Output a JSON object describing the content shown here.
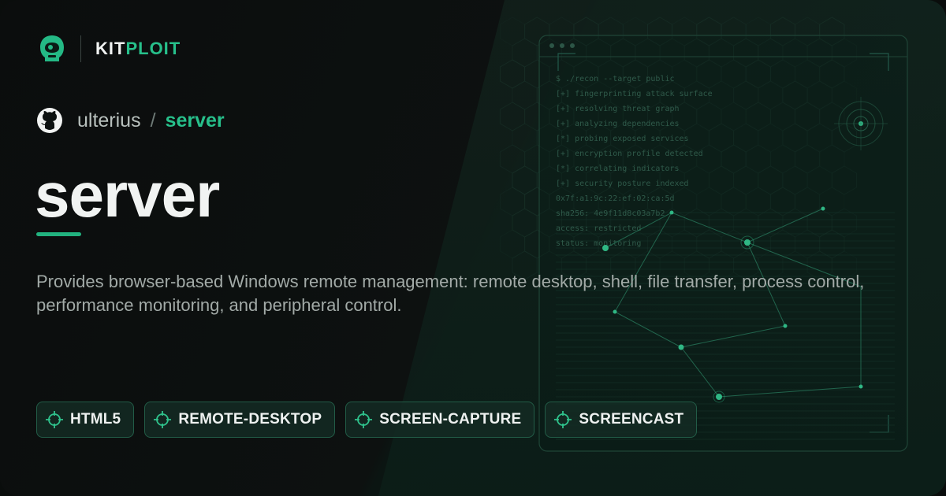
{
  "brand": {
    "name_part1": "KIT",
    "name_part2": "PLOIT",
    "logo_icon": "helmet-logo-icon"
  },
  "repo": {
    "icon": "github-icon",
    "owner": "ulterius",
    "separator": "/",
    "name": "server"
  },
  "title": "server",
  "description": "Provides browser-based Windows remote management: remote desktop, shell, file transfer, process control, performance monitoring, and peripheral control.",
  "tags": [
    {
      "icon": "crosshair-icon",
      "label": "HTML5"
    },
    {
      "icon": "crosshair-icon",
      "label": "REMOTE-DESKTOP"
    },
    {
      "icon": "crosshair-icon",
      "label": "SCREEN-CAPTURE"
    },
    {
      "icon": "crosshair-icon",
      "label": "SCREENCAST"
    }
  ],
  "terminal": {
    "lines": [
      "$ ./recon --target public",
      "[+] fingerprinting attack surface",
      "[+] resolving threat graph",
      "[+] analyzing dependencies",
      "[*] probing exposed services",
      "[+] encryption profile detected",
      "[*] correlating indicators",
      "[+] security posture indexed",
      "0x7f:a1:9c:22:ef:02:ca:5d",
      "sha256: 4e9f11d8c03a7b2",
      "access: restricted",
      "status: monitoring"
    ]
  },
  "colors": {
    "accent": "#27c08b",
    "background": "#0b0d0d",
    "text": "#f1f3f2",
    "muted": "#a2aaa7"
  }
}
